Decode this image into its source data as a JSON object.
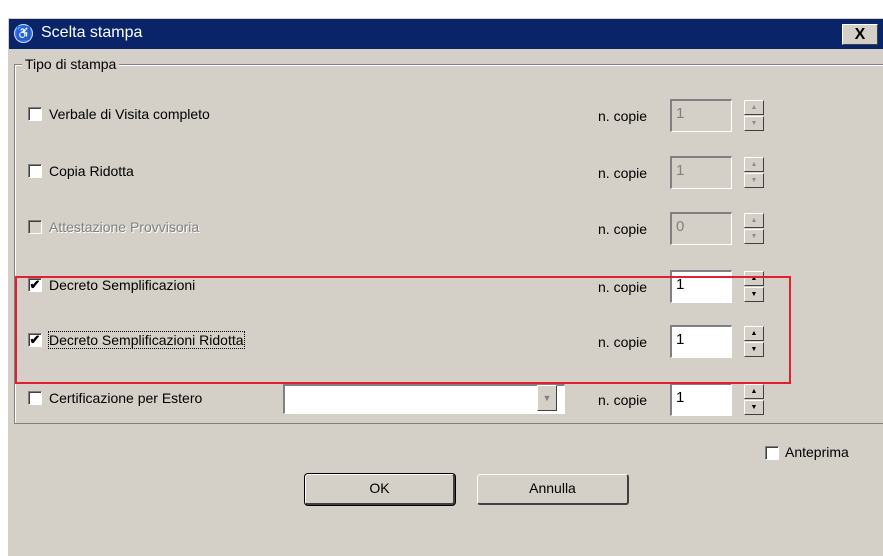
{
  "window": {
    "title": "Scelta stampa",
    "app_icon": "wheelchair-icon",
    "close_label": "X"
  },
  "group": {
    "legend": "Tipo di stampa",
    "copies_label": "n. copie",
    "rows": [
      {
        "label": "Verbale di Visita completo",
        "checked": false,
        "enabled": true,
        "copies": "1",
        "copies_enabled": false
      },
      {
        "label": "Copia Ridotta",
        "checked": false,
        "enabled": true,
        "copies": "1",
        "copies_enabled": false
      },
      {
        "label": "Attestazione Provvisoria",
        "checked": false,
        "enabled": false,
        "copies": "0",
        "copies_enabled": false
      },
      {
        "label": "Decreto Semplificazioni",
        "checked": true,
        "enabled": true,
        "copies": "1",
        "copies_enabled": true
      },
      {
        "label": "Decreto Semplificazioni Ridotta",
        "checked": true,
        "enabled": true,
        "copies": "1",
        "copies_enabled": true
      },
      {
        "label": "Certificazione per Estero",
        "checked": false,
        "enabled": true,
        "copies": "1",
        "copies_enabled": true,
        "combo_value": ""
      }
    ]
  },
  "options": {
    "anteprima_label": "Anteprima",
    "anteprima_checked": false
  },
  "buttons": {
    "ok_label": "OK",
    "cancel_label": "Annulla"
  },
  "colors": {
    "titlebar": "#0a246a",
    "dialog_bg": "#d4d0c8",
    "highlight": "#e02030"
  }
}
